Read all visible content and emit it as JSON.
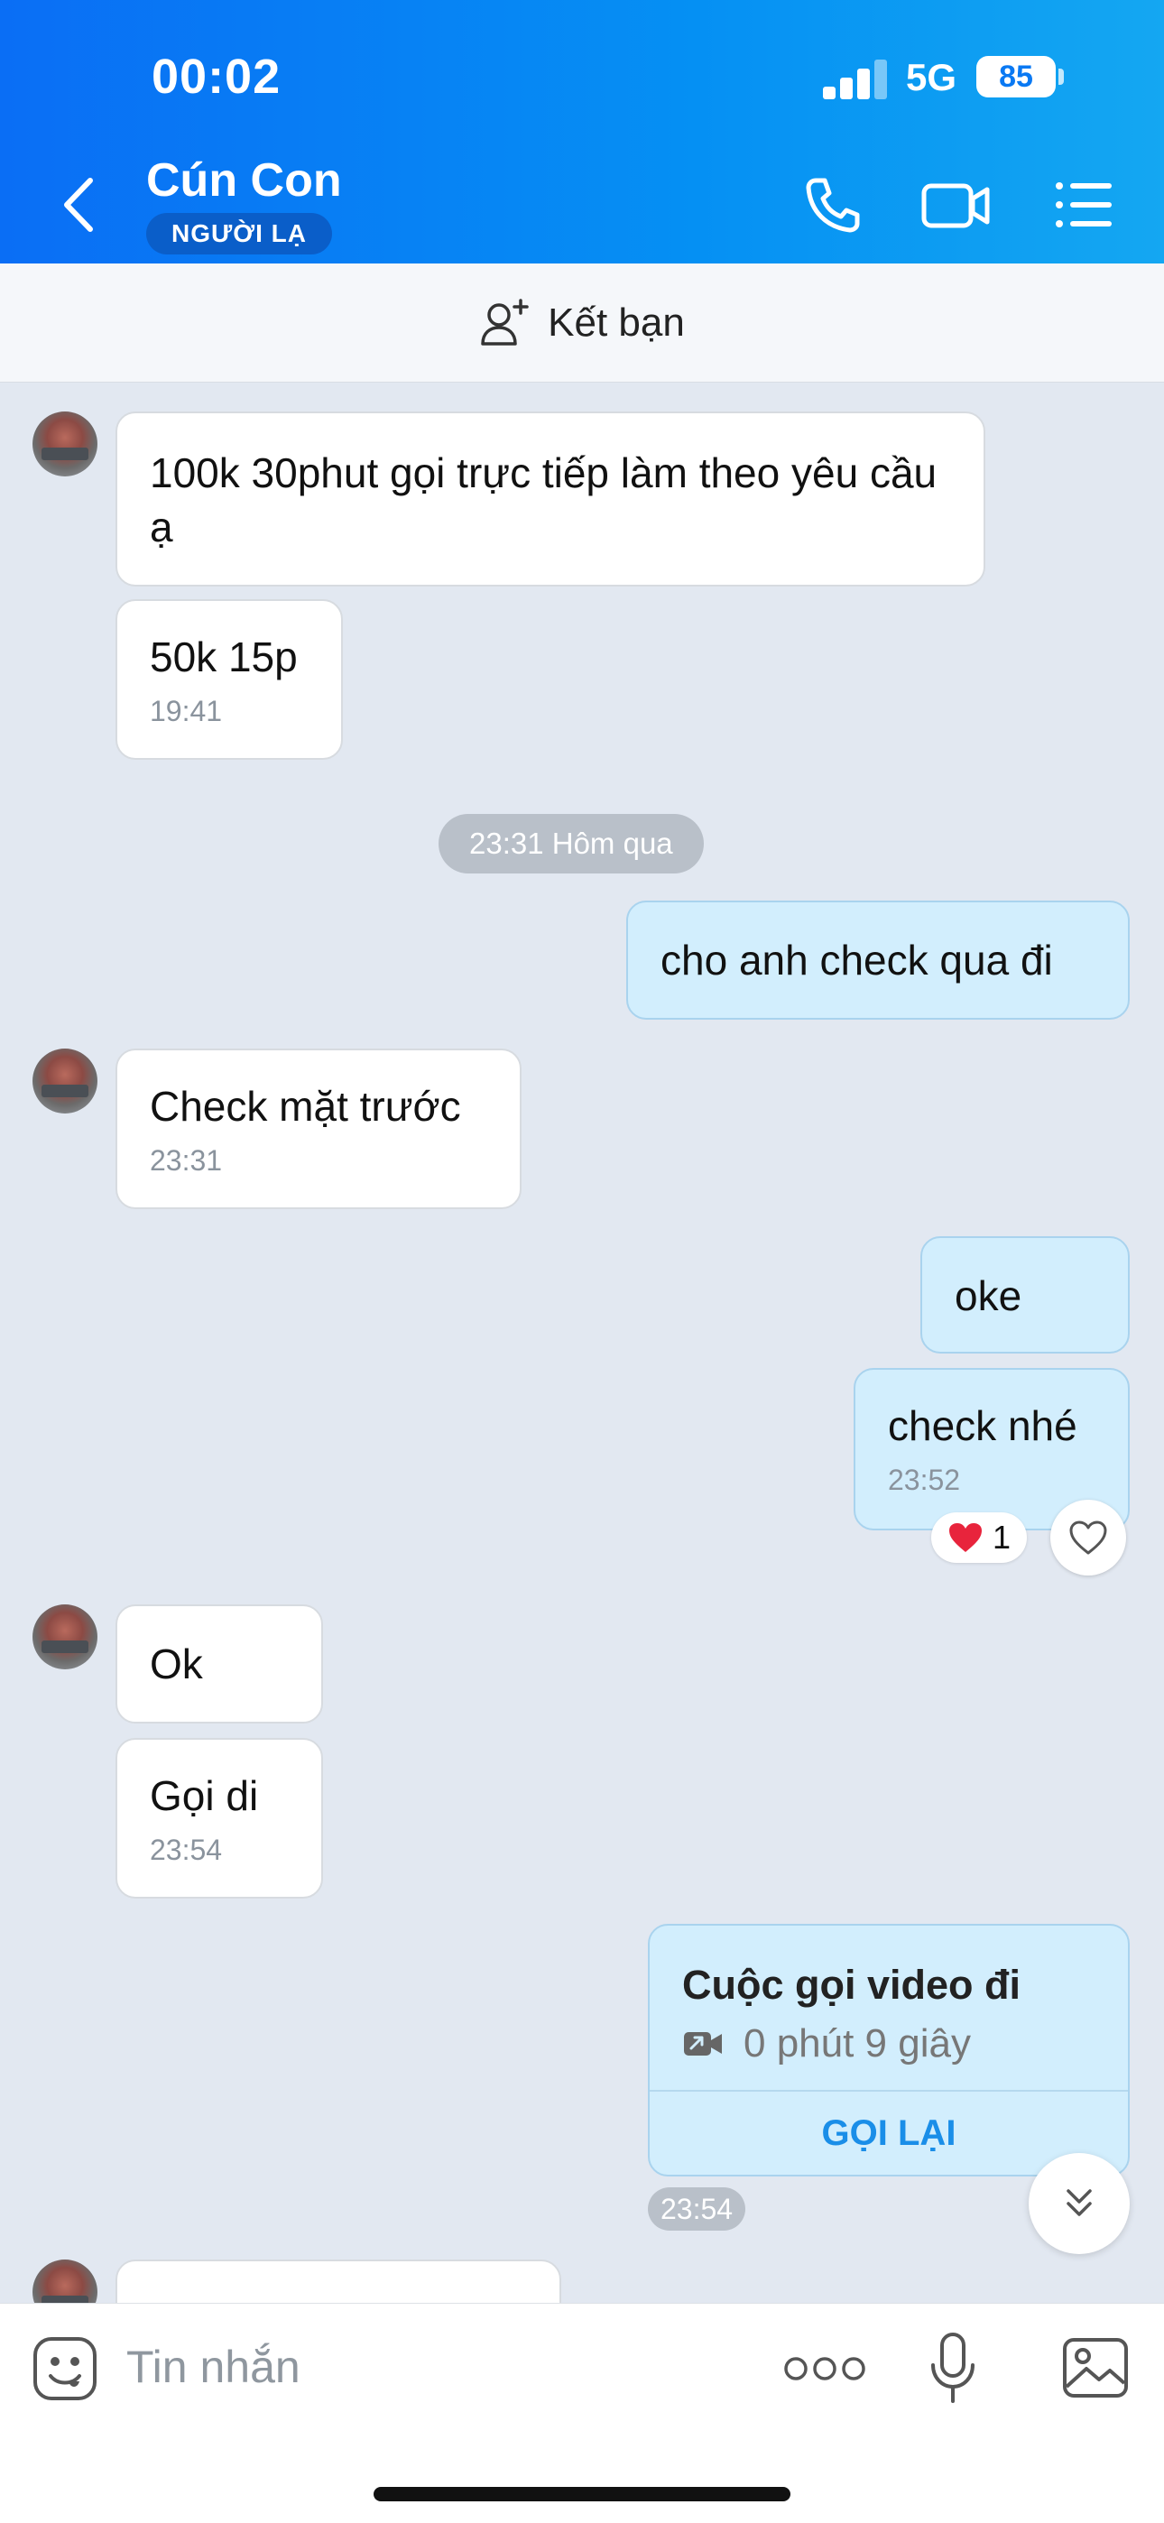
{
  "status_bar": {
    "time": "00:02",
    "network": "5G",
    "battery": "85"
  },
  "header": {
    "contact_name": "Cún Con",
    "badge": "NGƯỜI LẠ",
    "icons": [
      "back-chevron-icon",
      "phone-icon",
      "video-camera-icon",
      "menu-list-icon"
    ]
  },
  "friend_bar": {
    "label": "Kết bạn",
    "icon": "add-user-icon"
  },
  "messages": [
    {
      "side": "in",
      "text": "100k 30phut gọi trực tiếp làm theo yêu cầu ạ"
    },
    {
      "side": "in",
      "text": "50k 15p",
      "time": "19:41"
    },
    {
      "side": "divider",
      "text": "23:31 Hôm qua"
    },
    {
      "side": "out",
      "text": "cho anh check qua đi"
    },
    {
      "side": "in",
      "text": "Check mặt trước",
      "time": "23:31"
    },
    {
      "side": "out",
      "text": "oke"
    },
    {
      "side": "out",
      "text": "check nhé",
      "time": "23:52",
      "reaction": {
        "emoji": "❤️",
        "count": "1"
      }
    },
    {
      "side": "in",
      "text": "Ok"
    },
    {
      "side": "in",
      "text": "Gọi di",
      "time": "23:54"
    },
    {
      "side": "out",
      "type": "video_call",
      "title": "Cuộc gọi video đi",
      "duration": "0 phút 9 giây",
      "action": "GỌI LẠI",
      "time": "23:54"
    }
  ],
  "composer": {
    "placeholder": "Tin nhắn",
    "icons": [
      "sticker-icon",
      "more-dots-icon",
      "microphone-icon",
      "image-icon"
    ]
  },
  "colors": {
    "header_start": "#0a6ef5",
    "header_end": "#14a7f2",
    "chat_bg": "#e2e8f1",
    "out_bubble": "#d2eefd",
    "accent": "#1a8ee8"
  }
}
